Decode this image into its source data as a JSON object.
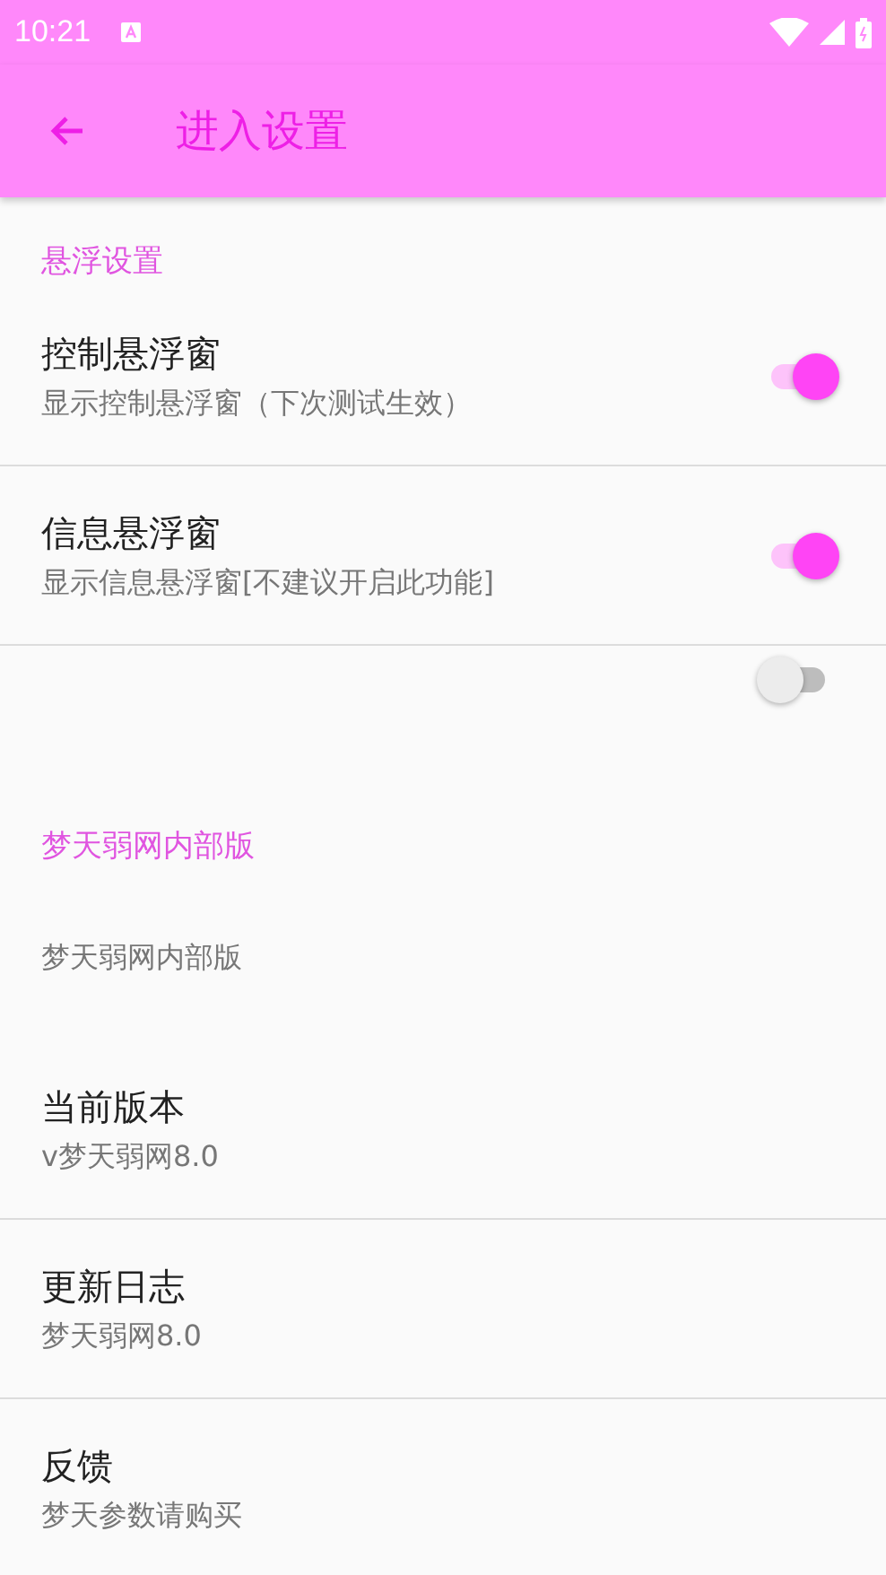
{
  "status_bar": {
    "time": "10:21"
  },
  "toolbar": {
    "title": "进入设置"
  },
  "sections": [
    {
      "header": "悬浮设置",
      "items": [
        {
          "kind": "switch",
          "title": "控制悬浮窗",
          "summary": "显示控制悬浮窗（下次测试生效）",
          "on": true
        },
        {
          "kind": "switch",
          "title": "信息悬浮窗",
          "summary": "显示信息悬浮窗[不建议开启此功能]",
          "on": true
        },
        {
          "kind": "switch",
          "on": false
        }
      ]
    },
    {
      "header": "梦天弱网内部版",
      "items": [
        {
          "kind": "note",
          "summary": "梦天弱网内部版"
        },
        {
          "kind": "text",
          "title": "当前版本",
          "summary": "v梦天弱网8.0"
        },
        {
          "kind": "text",
          "title": "更新日志",
          "summary": "梦天弱网8.0"
        },
        {
          "kind": "text",
          "title": "反馈",
          "summary": "梦天参数请购买"
        }
      ]
    }
  ]
}
